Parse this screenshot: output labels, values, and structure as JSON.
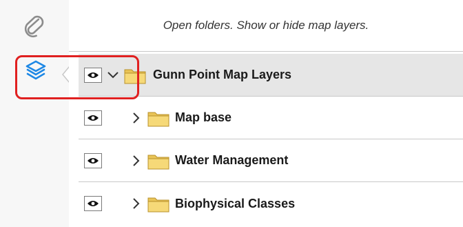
{
  "rail": {
    "attachment_icon": "paperclip-icon",
    "layers_icon": "layers-icon",
    "accent_color": "#1e88e5"
  },
  "panel": {
    "hint": "Open folders. Show or hide map layers."
  },
  "layers": [
    {
      "label": "Gunn Point Map Layers",
      "expanded": true,
      "selected": true
    },
    {
      "label": "Map base",
      "expanded": false,
      "selected": false
    },
    {
      "label": "Water Management",
      "expanded": false,
      "selected": false
    },
    {
      "label": "Biophysical Classes",
      "expanded": false,
      "selected": false
    }
  ],
  "colors": {
    "highlight": "#e02020",
    "selected_row": "#e6e6e6",
    "folder": "#f2d26a"
  }
}
